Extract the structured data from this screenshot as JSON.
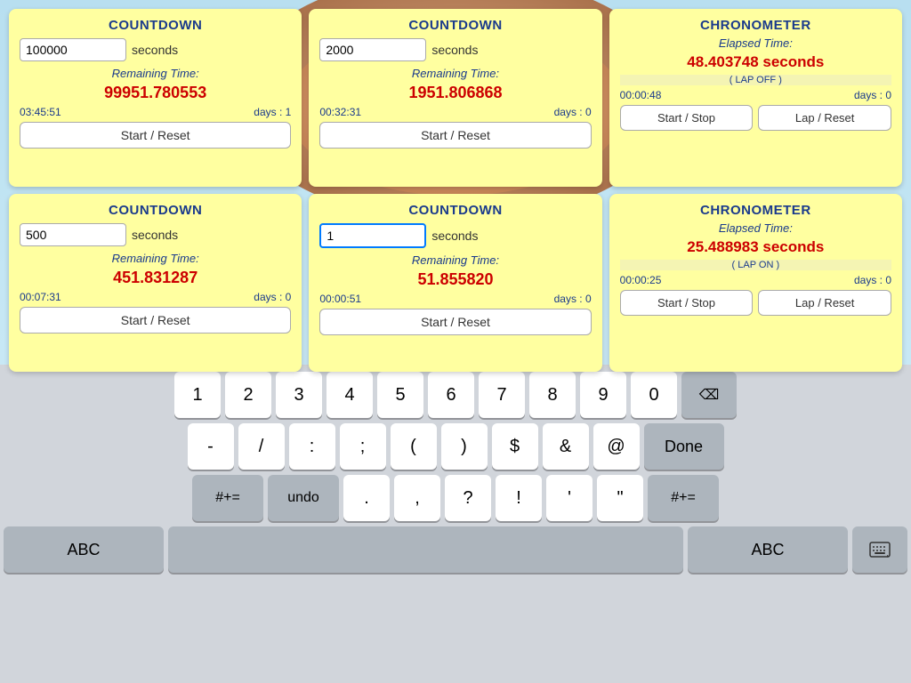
{
  "background": {
    "color": "#b8dff0"
  },
  "tiles": [
    {
      "id": "countdown-1",
      "type": "countdown",
      "title": "COUNTDOWN",
      "input_value": "100000",
      "seconds_label": "seconds",
      "remaining_label": "Remaining Time:",
      "remaining_value": "99951.780553",
      "time_hms": "03:45:51",
      "days": "days : 1",
      "button_label": "Start / Reset"
    },
    {
      "id": "countdown-2",
      "type": "countdown",
      "title": "COUNTDOWN",
      "input_value": "2000",
      "seconds_label": "seconds",
      "remaining_label": "Remaining Time:",
      "remaining_value": "1951.806868",
      "time_hms": "00:32:31",
      "days": "days : 0",
      "button_label": "Start / Reset"
    },
    {
      "id": "chronometer-1",
      "type": "chronometer",
      "title": "CHRONOMETER",
      "elapsed_label": "Elapsed Time:",
      "elapsed_value": "48.403748 seconds",
      "lap_status": "( LAP OFF )",
      "time_hms": "00:00:48",
      "days": "days : 0",
      "btn_start_stop": "Start / Stop",
      "btn_lap_reset": "Lap / Reset"
    },
    {
      "id": "countdown-3",
      "type": "countdown",
      "title": "COUNTDOWN",
      "input_value": "500",
      "seconds_label": "seconds",
      "remaining_label": "Remaining Time:",
      "remaining_value": "451.831287",
      "time_hms": "00:07:31",
      "days": "days : 0",
      "button_label": "Start / Reset"
    },
    {
      "id": "countdown-4",
      "type": "countdown",
      "title": "COUNTDOWN",
      "input_value": "1",
      "input_focused": true,
      "seconds_label": "seconds",
      "remaining_label": "Remaining Time:",
      "remaining_value": "51.855820",
      "time_hms": "00:00:51",
      "days": "days : 0",
      "button_label": "Start / Reset"
    },
    {
      "id": "chronometer-2",
      "type": "chronometer",
      "title": "CHRONOMETER",
      "elapsed_label": "Elapsed Time:",
      "elapsed_value": "25.488983 seconds",
      "lap_status": "( LAP ON )",
      "time_hms": "00:00:25",
      "days": "days : 0",
      "btn_start_stop": "Start / Stop",
      "btn_lap_reset": "Lap / Reset"
    }
  ],
  "keyboard": {
    "rows": [
      {
        "keys": [
          {
            "label": "1",
            "type": "normal"
          },
          {
            "label": "2",
            "type": "normal"
          },
          {
            "label": "3",
            "type": "normal"
          },
          {
            "label": "4",
            "type": "normal"
          },
          {
            "label": "5",
            "type": "normal"
          },
          {
            "label": "6",
            "type": "normal"
          },
          {
            "label": "7",
            "type": "normal"
          },
          {
            "label": "8",
            "type": "normal"
          },
          {
            "label": "9",
            "type": "normal"
          },
          {
            "label": "0",
            "type": "normal"
          },
          {
            "label": "⌫",
            "type": "backspace"
          }
        ]
      },
      {
        "keys": [
          {
            "label": "-",
            "type": "normal"
          },
          {
            "label": "/",
            "type": "normal"
          },
          {
            "label": ":",
            "type": "normal"
          },
          {
            "label": ";",
            "type": "normal"
          },
          {
            "label": "(",
            "type": "normal"
          },
          {
            "label": ")",
            "type": "normal"
          },
          {
            "label": "$",
            "type": "normal"
          },
          {
            "label": "&",
            "type": "normal"
          },
          {
            "label": "@",
            "type": "normal"
          },
          {
            "label": "Done",
            "type": "done"
          }
        ]
      },
      {
        "keys": [
          {
            "label": "#+= ",
            "type": "dark-wide",
            "display": "#+="
          },
          {
            "label": "undo",
            "type": "dark-wide",
            "display": "undo"
          },
          {
            "label": ".",
            "type": "normal"
          },
          {
            "label": ",",
            "type": "normal"
          },
          {
            "label": "?",
            "type": "normal"
          },
          {
            "label": "!",
            "type": "normal"
          },
          {
            "label": "'",
            "type": "normal"
          },
          {
            "label": "\"",
            "type": "normal"
          },
          {
            "label": "#+=",
            "type": "dark-wide",
            "display": "#+="
          }
        ]
      },
      {
        "keys": [
          {
            "label": "ABC",
            "type": "abc"
          },
          {
            "label": "",
            "type": "space"
          },
          {
            "label": "ABC",
            "type": "abc"
          },
          {
            "label": "⌨",
            "type": "keyboard-icon"
          }
        ]
      }
    ]
  }
}
